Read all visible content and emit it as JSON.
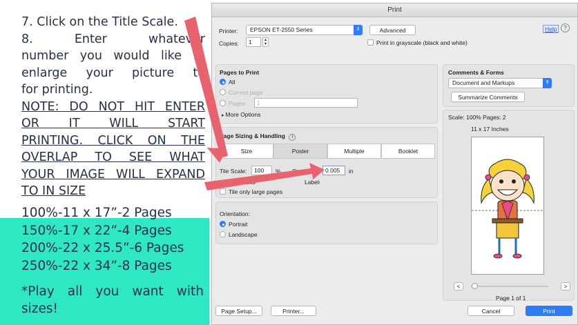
{
  "instructions": {
    "step7": "7. Click on the Title Scale.",
    "step8_lines": [
      "8.   Enter   whatever",
      "number you would like to",
      "enlarge your picture to",
      "for printing."
    ],
    "note_lines": [
      "NOTE: DO NOT HIT ENTER",
      "OR    IT    WILL    START",
      "PRINTING.  CLICK ON THE",
      "OVERLAP TO SEE WHAT",
      "YOUR IMAGE WILL EXPAND",
      "TO IN SIZE"
    ],
    "note_head": "NOTE:",
    "sizes": [
      "100%-11 x 17”-2 Pages",
      "150%-17 x 22”-4 Pages",
      "200%-22 x 25.5”-6 Pages",
      "250%-22 x 34”-8 Pages"
    ],
    "play_lines": [
      "*Play all you want with",
      "sizes!"
    ],
    "teal_color": "#2ee8c3"
  },
  "dialog": {
    "title": "Print",
    "help_label": "Help",
    "printer_label": "Printer:",
    "printer_value": "EPSON ET-2550 Series",
    "advanced_label": "Advanced",
    "copies_label": "Copies:",
    "copies_value": "1",
    "grayscale_label": "Print in grayscale (black and white)",
    "pages_to_print": {
      "title": "Pages to Print",
      "all": "All",
      "current": "Current page",
      "pages": "Pages",
      "pages_value": "1",
      "more_options": "More Options"
    },
    "sizing": {
      "title": "Page Sizing & Handling",
      "tabs": [
        "Size",
        "Poster",
        "Multiple",
        "Booklet"
      ],
      "selected_tab": "Poster",
      "tile_scale_label": "Tile Scale:",
      "tile_scale_value": "100",
      "percent": "%",
      "overlap_label": "Overlap:",
      "overlap_value": "0.005",
      "overlap_unit": "in",
      "cut_marks": "Cut marks",
      "labels_partial": "Labels",
      "tile_only_large": "Tile only large pages"
    },
    "orientation": {
      "title": "Orientation:",
      "portrait": "Portrait",
      "landscape": "Landscape"
    },
    "comments": {
      "title": "Comments & Forms",
      "value": "Document and Markups",
      "summarize": "Summarize Comments"
    },
    "preview": {
      "scale_text": "Scale: 100% Pages: 2",
      "paper_size": "11 x 17 Inches",
      "page_indicator": "Page 1 of 1",
      "prev": "<",
      "next": ">"
    },
    "page_setup": "Page Setup...",
    "printer_btn": "Printer...",
    "cancel": "Cancel",
    "print": "Print",
    "accent": "#2f7cf6",
    "arrow_color": "#e8636e"
  }
}
